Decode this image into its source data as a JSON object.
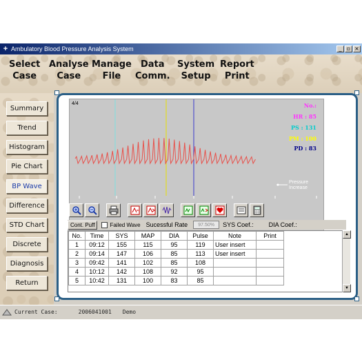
{
  "window": {
    "title": "Ambulatory Blood Pressure Analysis System",
    "controls": [
      "_",
      "▫",
      "×"
    ]
  },
  "menu": [
    {
      "line1": "Select",
      "line2": "Case"
    },
    {
      "line1": "Analyse",
      "line2": "Case"
    },
    {
      "line1": "Manage",
      "line2": "File"
    },
    {
      "line1": "Data",
      "line2": "Comm."
    },
    {
      "line1": "System",
      "line2": "Setup"
    },
    {
      "line1": "Report",
      "line2": "Print"
    }
  ],
  "sidebar": {
    "items": [
      "Summary",
      "Trend",
      "Histogram",
      "Pie Chart",
      "BP Wave",
      "Difference",
      "STD Chart",
      "Discrete",
      "Diagnosis",
      "Return"
    ],
    "active": "BP Wave"
  },
  "wave": {
    "counter": "4/4",
    "info": [
      {
        "label": "No.:",
        "color": "#ff33ff"
      },
      {
        "label": "HR : 85",
        "color": "#ff33ff"
      },
      {
        "label": "PS : 131",
        "color": "#00cccc"
      },
      {
        "label": "PM : 100",
        "color": "#ffff00"
      },
      {
        "label": "PD : 83",
        "color": "#000088"
      }
    ],
    "legend": "Pressure\nIncrease",
    "colors": {
      "wave": "#e8504a",
      "marker_cyan": "#7ee0e0",
      "marker_yellow": "#e8e000",
      "marker_blue": "#3a3acc"
    }
  },
  "toolbar": {
    "buttons": [
      "zoom-in-icon",
      "zoom-out-icon",
      "print-icon",
      "bp-prev-icon",
      "bp-next-icon",
      "wave-icon",
      "hr-prev-icon",
      "hr-next-icon",
      "heart-icon",
      "export-icon",
      "calculator-icon"
    ]
  },
  "status_row": {
    "cont_puff": "Cont. Puff",
    "failed_wave": "Failed Wave",
    "success_rate_label": "Sucessful Rate",
    "success_rate_value": "97.50%",
    "sys_coef": "SYS Coef.:",
    "dia_coef": "DIA Coef.:"
  },
  "table": {
    "headers": [
      "No.",
      "Time",
      "SYS",
      "MAP",
      "DIA",
      "Pulse",
      "Note",
      "Print"
    ],
    "rows": [
      [
        "1",
        "09:12",
        "155",
        "115",
        "95",
        "119",
        "User insert",
        ""
      ],
      [
        "2",
        "09:14",
        "147",
        "106",
        "85",
        "113",
        "User insert",
        ""
      ],
      [
        "3",
        "09:42",
        "141",
        "102",
        "85",
        "108",
        "",
        ""
      ],
      [
        "4",
        "10:12",
        "142",
        "108",
        "92",
        "95",
        "",
        ""
      ],
      [
        "5",
        "10:42",
        "131",
        "100",
        "83",
        "85",
        "",
        ""
      ]
    ]
  },
  "statusbar": {
    "label": "Current Case:",
    "case_id": "2006041001",
    "case_name": "Demo"
  }
}
